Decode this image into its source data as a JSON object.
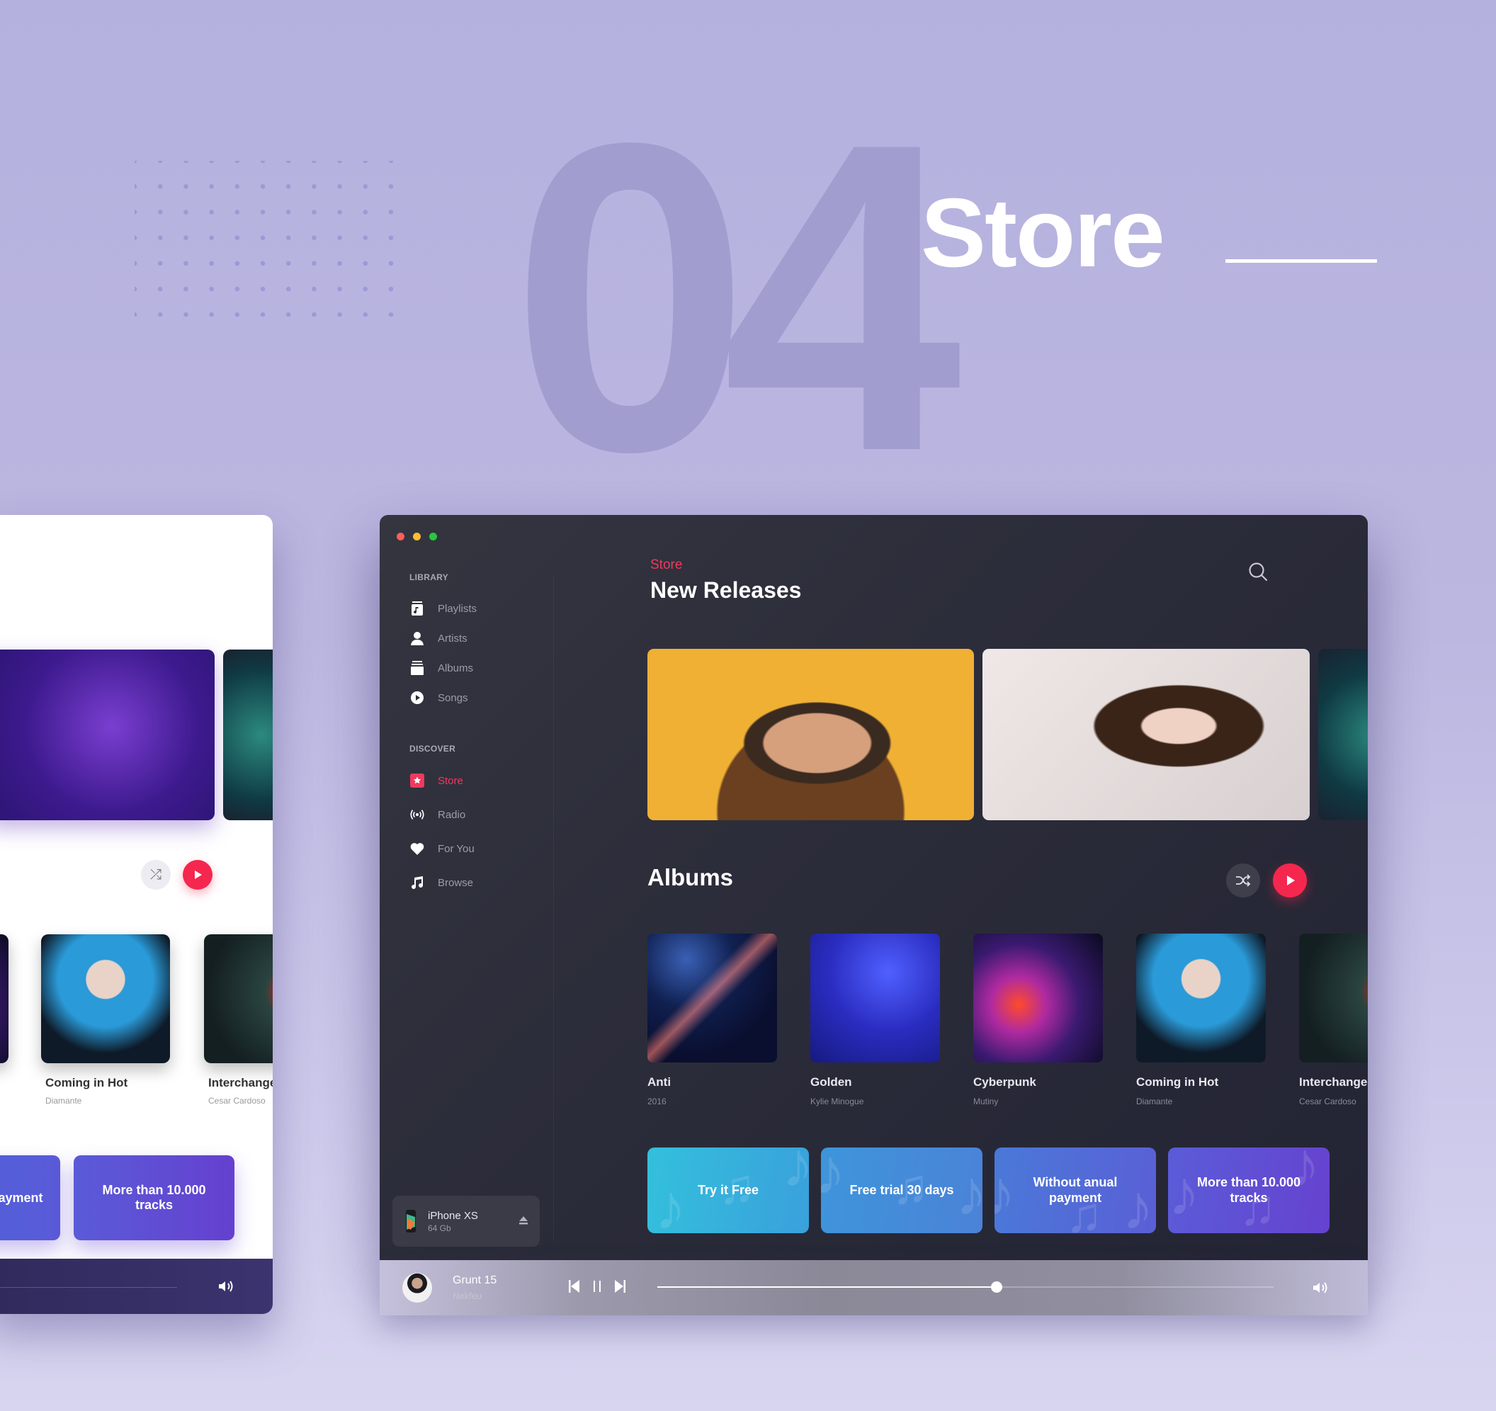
{
  "hero": {
    "number": "04",
    "title": "Store"
  },
  "window_controls": {
    "close_color": "#fe5f57",
    "minimize_color": "#febc2e",
    "maximize_color": "#28c840"
  },
  "sidebar": {
    "library_label": "LIBRARY",
    "library_items": [
      {
        "label": "Playlists",
        "icon": "playlist-icon"
      },
      {
        "label": "Artists",
        "icon": "artist-icon"
      },
      {
        "label": "Albums",
        "icon": "albums-icon"
      },
      {
        "label": "Songs",
        "icon": "songs-icon"
      }
    ],
    "discover_label": "DISCOVER",
    "discover_items": [
      {
        "label": "Store",
        "icon": "store-star-icon",
        "active": true
      },
      {
        "label": "Radio",
        "icon": "radio-icon"
      },
      {
        "label": "For You",
        "icon": "heart-icon"
      },
      {
        "label": "Browse",
        "icon": "music-note-icon"
      }
    ],
    "device": {
      "name": "iPhone XS",
      "capacity": "64 Gb"
    }
  },
  "main": {
    "breadcrumb": "Store",
    "title": "New Releases",
    "albums_title": "Albums",
    "albums": [
      {
        "title": "Anti",
        "subtitle": "2016"
      },
      {
        "title": "Golden",
        "subtitle": "Kylie Minogue"
      },
      {
        "title": "Cyberpunk",
        "subtitle": "Mutiny"
      },
      {
        "title": "Coming in Hot",
        "subtitle": "Diamante"
      },
      {
        "title": "Interchange",
        "subtitle": "Cesar Cardoso"
      }
    ],
    "promos": [
      {
        "label": "Try it Free"
      },
      {
        "label": "Free trial 30 days"
      },
      {
        "label": "Without anual payment"
      },
      {
        "label": "More than 10.000 tracks"
      }
    ]
  },
  "player": {
    "track": "Grunt 15",
    "artist": "Nekfeu",
    "progress_percent": 55
  },
  "light_window": {
    "albums": [
      {
        "title": "Coming in Hot",
        "subtitle": "Diamante"
      },
      {
        "title": "Interchange",
        "subtitle": "Cesar Cardoso"
      }
    ],
    "promos": [
      {
        "label": "anual payment"
      },
      {
        "label": "More than 10.000 tracks"
      }
    ]
  },
  "colors": {
    "accent": "#f5274e",
    "background": "#b4b1df",
    "window_dark": "#2c2d3a"
  }
}
